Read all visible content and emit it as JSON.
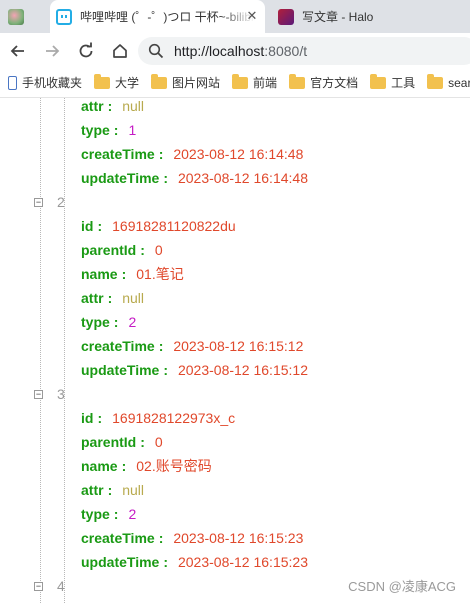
{
  "tabs": [
    {
      "title": ""
    },
    {
      "title": "哔哩哔哩 (゜-゜)つロ 干杯~-bilibili"
    },
    {
      "title": "写文章 - Halo"
    }
  ],
  "address": {
    "host": "http://localhost",
    "rest": ":8080/t"
  },
  "bookmarks": [
    "手机收藏夹",
    "大学",
    "图片网站",
    "前端",
    "官方文档",
    "工具",
    "sear"
  ],
  "records": [
    {
      "index": "",
      "fields": [
        {
          "key": "attr",
          "value": "null",
          "kind": "null"
        },
        {
          "key": "type",
          "value": "1",
          "kind": "num"
        },
        {
          "key": "createTime",
          "value": "2023-08-12 16:14:48",
          "kind": "str"
        },
        {
          "key": "updateTime",
          "value": "2023-08-12 16:14:48",
          "kind": "str"
        }
      ]
    },
    {
      "index": "2",
      "fields": [
        {
          "key": "id",
          "value": "16918281120822du",
          "kind": "str"
        },
        {
          "key": "parentId",
          "value": "0",
          "kind": "str"
        },
        {
          "key": "name",
          "value": "01.笔记",
          "kind": "str"
        },
        {
          "key": "attr",
          "value": "null",
          "kind": "null"
        },
        {
          "key": "type",
          "value": "2",
          "kind": "num"
        },
        {
          "key": "createTime",
          "value": "2023-08-12 16:15:12",
          "kind": "str"
        },
        {
          "key": "updateTime",
          "value": "2023-08-12 16:15:12",
          "kind": "str"
        }
      ]
    },
    {
      "index": "3",
      "fields": [
        {
          "key": "id",
          "value": "1691828122973x_c",
          "kind": "str"
        },
        {
          "key": "parentId",
          "value": "0",
          "kind": "str"
        },
        {
          "key": "name",
          "value": "02.账号密码",
          "kind": "str"
        },
        {
          "key": "attr",
          "value": "null",
          "kind": "null"
        },
        {
          "key": "type",
          "value": "2",
          "kind": "num"
        },
        {
          "key": "createTime",
          "value": "2023-08-12 16:15:23",
          "kind": "str"
        },
        {
          "key": "updateTime",
          "value": "2023-08-12 16:15:23",
          "kind": "str"
        }
      ]
    },
    {
      "index": "4",
      "fields": []
    }
  ],
  "toggle_symbol": "−",
  "watermark": "CSDN @凌康ACG"
}
